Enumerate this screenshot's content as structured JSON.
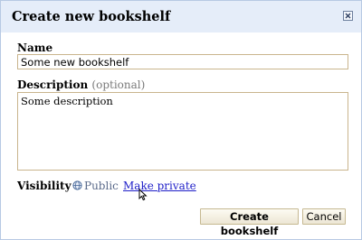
{
  "dialog": {
    "title": "Create new bookshelf",
    "close_icon": "close-icon"
  },
  "name_field": {
    "label": "Name",
    "value": "Some new bookshelf"
  },
  "description_field": {
    "label": "Description",
    "optional_hint": "(optional)",
    "value": "Some description"
  },
  "visibility": {
    "label": "Visibility",
    "current_icon": "globe-icon",
    "current_value": "Public",
    "toggle_link": "Make private"
  },
  "actions": {
    "create_label": "Create bookshelf",
    "cancel_label": "Cancel"
  },
  "colors": {
    "titlebar_bg": "#e5edf9",
    "link": "#1e1ec8",
    "input_border": "#c9b58d"
  }
}
